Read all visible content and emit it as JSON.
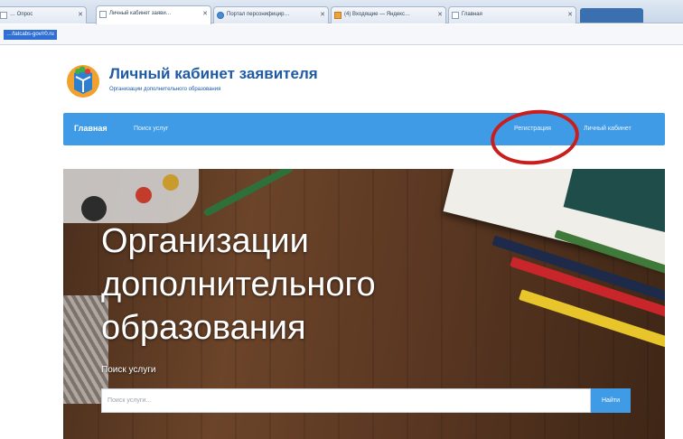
{
  "browser": {
    "tabs": [
      {
        "label": "… Опрос",
        "icon": "page-icon"
      },
      {
        "label": "Личный кабинет заяви…",
        "icon": "page-icon"
      },
      {
        "label": "Портал персонифицир…",
        "icon": "globe-icon"
      },
      {
        "label": "(4) Входящие — Яндекс…",
        "icon": "mail-icon"
      },
      {
        "label": "Главная",
        "icon": "page-icon"
      }
    ],
    "url": "…/tatcabs-gov/r0.ru"
  },
  "header": {
    "title": "Личный кабинет заявителя",
    "subtitle": "Организации дополнительного образования"
  },
  "nav": {
    "home": "Главная",
    "search": "Поиск услуг",
    "register": "Регистрация",
    "cabinet": "Личный кабинет"
  },
  "hero": {
    "title_lines": [
      "Организации",
      "дополнительного",
      "образования"
    ],
    "search_label": "Поиск услуги",
    "search_placeholder": "Поиск услуги…",
    "search_button": "Найти"
  },
  "colors": {
    "brand_blue": "#1f5aa6",
    "navbar": "#3f9be6",
    "annotation": "#c81e1e"
  }
}
